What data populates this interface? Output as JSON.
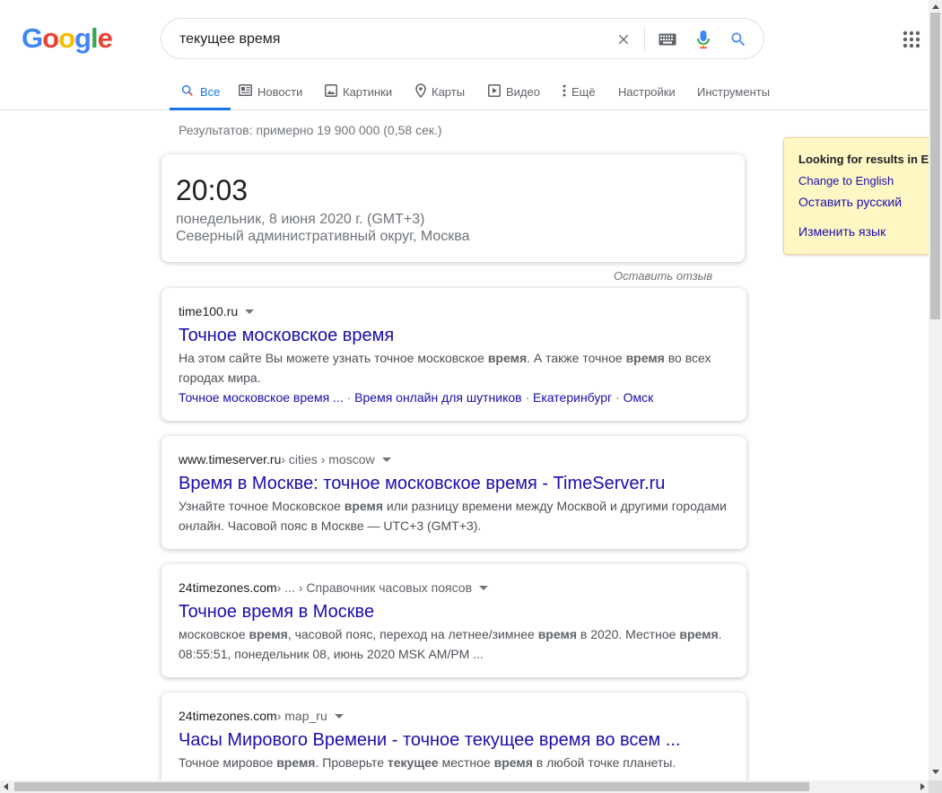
{
  "logo": {
    "letters": [
      "G",
      "o",
      "o",
      "g",
      "l",
      "e"
    ],
    "colors": [
      "#4285f4",
      "#ea4335",
      "#fbbc05",
      "#4285f4",
      "#34a853",
      "#ea4335"
    ]
  },
  "search": {
    "query": "текущее время"
  },
  "tabs": [
    {
      "label": "Все",
      "icon": "search-icon",
      "active": true
    },
    {
      "label": "Новости",
      "icon": "news-icon"
    },
    {
      "label": "Картинки",
      "icon": "image-icon"
    },
    {
      "label": "Карты",
      "icon": "map-pin-icon"
    },
    {
      "label": "Видео",
      "icon": "video-icon"
    },
    {
      "label": "Ещё",
      "icon": "more-vert-icon"
    },
    {
      "label": "Настройки"
    },
    {
      "label": "Инструменты"
    }
  ],
  "stats": "Результатов: примерно 19 900 000 (0,58 сек.)",
  "clock": {
    "time": "20:03",
    "date": "понедельник, 8 июня 2020 г. (GMT+3)",
    "location": "Северный административный округ, Москва",
    "feedback": "Оставить отзыв"
  },
  "results": [
    {
      "domain": "time100.ru",
      "crumbs": "",
      "title": "Точное московское время",
      "snippet": [
        {
          "t": "На этом сайте Вы можете узнать точное московское "
        },
        {
          "t": "время",
          "b": true
        },
        {
          "t": ". А также точное "
        },
        {
          "t": "время",
          "b": true
        },
        {
          "t": " во всех городах мира."
        }
      ],
      "links": [
        "Точное московское время ...",
        "Время онлайн для шутников",
        "Екатеринбург",
        "Омск"
      ]
    },
    {
      "domain": "www.timeserver.ru",
      "crumbs": " › cities › moscow",
      "title": "Время в Москве: точное московское время - TimeServer.ru",
      "snippet": [
        {
          "t": "Узнайте точное Московское "
        },
        {
          "t": "время",
          "b": true
        },
        {
          "t": " или разницу времени между Москвой и другими городами онлайн. Часовой пояс в Москве — UTC+3 (GMT+3)."
        }
      ],
      "links": []
    },
    {
      "domain": "24timezones.com",
      "crumbs": " › ... › Справочник часовых поясов",
      "title": "Точное время в Москве",
      "snippet": [
        {
          "t": "московское "
        },
        {
          "t": "время",
          "b": true
        },
        {
          "t": ", часовой пояс, переход на летнее/зимнее "
        },
        {
          "t": "время",
          "b": true
        },
        {
          "t": " в 2020. Местное "
        },
        {
          "t": "время",
          "b": true
        },
        {
          "t": ". 08:55:51, понедельник 08, июнь 2020 MSK AM/PM ..."
        }
      ],
      "links": []
    },
    {
      "domain": "24timezones.com",
      "crumbs": " › map_ru",
      "title": "Часы Мирового Времени - точное текущее время во всем ...",
      "snippet": [
        {
          "t": "Точное мировое "
        },
        {
          "t": "время",
          "b": true
        },
        {
          "t": ". Проверьте "
        },
        {
          "t": "текущее",
          "b": true
        },
        {
          "t": " местное "
        },
        {
          "t": "время",
          "b": true
        },
        {
          "t": " в любой точке планеты."
        }
      ],
      "links": []
    }
  ],
  "lang_panel": {
    "title": "Looking for results in English?",
    "change_en": "Change to English",
    "keep_ru": "Оставить русский",
    "change_lang": "Изменить язык"
  },
  "colors": {
    "accent": "#1a73e8",
    "link": "#1a0dab",
    "panel_bg": "#fff8c4"
  }
}
